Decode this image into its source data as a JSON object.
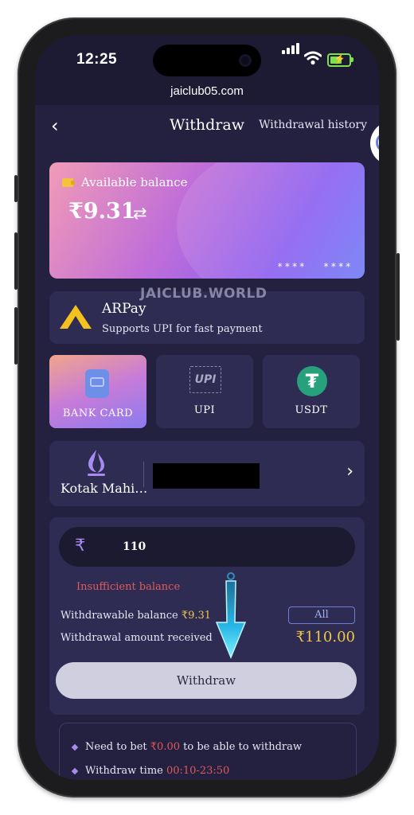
{
  "status": {
    "time": "12:25"
  },
  "browser": {
    "url": "jaiclub05.com"
  },
  "header": {
    "back_icon": "‹",
    "title": "Withdraw",
    "history_link": "Withdrawal history"
  },
  "balance_card": {
    "label": "Available balance",
    "amount": "₹9.31",
    "masked_1": "****",
    "masked_2": "****"
  },
  "watermark": "JAICLUB.WORLD",
  "channel": {
    "name": "ARPay",
    "subtitle": "Supports UPI for fast payment"
  },
  "methods": [
    {
      "label": "BANK CARD",
      "icon": "bank-card-icon",
      "selected": true
    },
    {
      "label": "UPI",
      "icon": "upi-icon",
      "icon_text": "UPI",
      "selected": false
    },
    {
      "label": "USDT",
      "icon": "usdt-icon",
      "icon_text": "₮",
      "selected": false
    }
  ],
  "bank": {
    "name": "Kotak Mahi…",
    "chevron": "›"
  },
  "form": {
    "currency_symbol": "₹",
    "amount_value": "110",
    "error": "Insufficient balance",
    "withdrawable_label": "Withdrawable balance ",
    "withdrawable_value": "₹9.31",
    "all_button": "All",
    "received_label": "Withdrawal amount received",
    "received_value": "₹110.00",
    "submit": "Withdraw"
  },
  "info": {
    "line1_pre": "Need to bet ",
    "line1_value": "₹0.00",
    "line1_post": " to be able to withdraw",
    "line2_pre": "Withdraw time ",
    "line2_value": "00:10-23:50"
  },
  "colors": {
    "background": "#23213f",
    "panel": "#2e2c52",
    "accent_gold": "#f0c54a",
    "error_red": "#e05a5a",
    "arrow_cyan": "#29c3f0"
  }
}
